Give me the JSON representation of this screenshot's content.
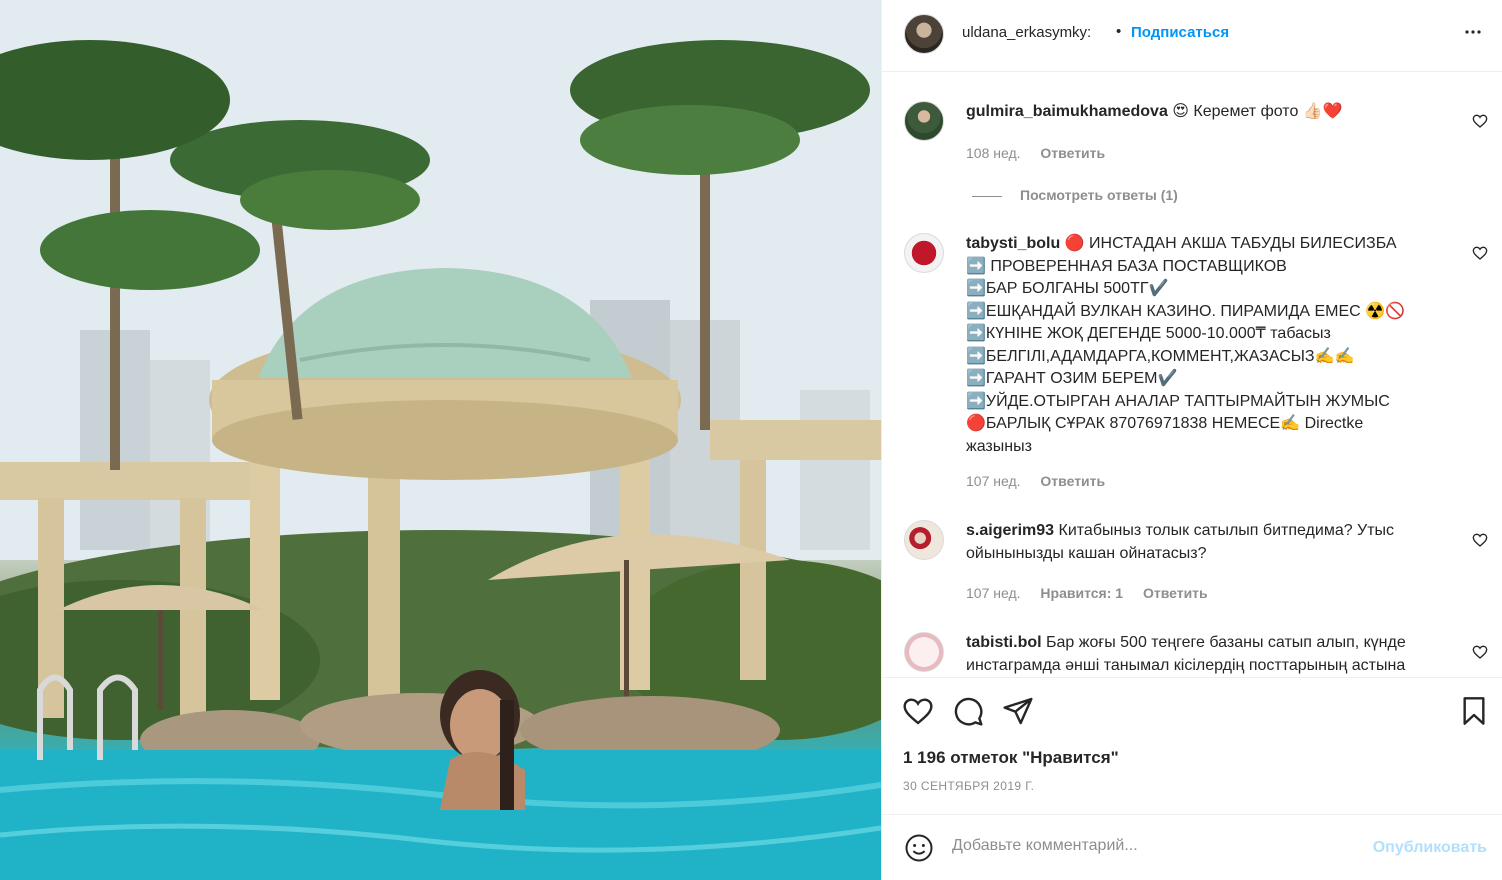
{
  "post": {
    "photo_icon": "pool-photo",
    "author": "uldana_erkasymky:",
    "separator": "•",
    "follow_label": "Подписаться",
    "more_icon": "more-horizontal-icon"
  },
  "comments": [
    {
      "user": "gulmira_baimukhamedova",
      "text": "😍 Керемет фото 👍🏻❤️",
      "time": "108 нед.",
      "reply": "Ответить",
      "view_replies": "Посмотреть ответы (1)"
    },
    {
      "user": "tabysti_bolu",
      "lines": [
        "🔴 ИНСТАДАН АКША ТАБУДЫ БИЛЕСИЗБА",
        "➡️ ПРОВЕРЕННАЯ БАЗА ПОСТАВЩИКОВ",
        "➡️БАР БОЛГАНЫ 500ТГ✔️",
        "➡️ЕШҚАНДАЙ ВУЛКАН КАЗИНО. ПИРАМИДА ЕМЕС ☢️🚫",
        "➡️КҮНІНЕ ЖОҚ ДЕГЕНДЕ 5000-10.000₸ табасыз",
        "➡️БЕЛГІЛІ,АДАМДАРГА,КОММЕНТ,ЖАЗАСЫЗ✍️✍️",
        "➡️ГАРАНТ ОЗИМ БЕРЕМ✔️",
        "➡️УЙДЕ.ОТЫРГАН АНАЛАР ТАПТЫРМАЙТЫН ЖУМЫС",
        "🔴БАРЛЫҚ СҰРАК 87076971838 НЕМЕСЕ✍️ Directke",
        "жазыныз"
      ],
      "time": "107 нед.",
      "reply": "Ответить"
    },
    {
      "user": "s.aigerim93",
      "text": "Китабыныз толык сатылып битпедима? Утыс ойынынызды кашан ойнатасыз?",
      "time": "107 нед.",
      "likes": "Нравится: 1",
      "reply": "Ответить"
    },
    {
      "user": "tabisti.bol",
      "text": "Бар жоғы 500 теңгеге базаны сатып алып, күнде инстаграмда әнші танымал кісілердің посттарының астына"
    }
  ],
  "actions": {
    "like_icon": "heart-icon",
    "comment_icon": "comment-icon",
    "share_icon": "share-icon",
    "save_icon": "bookmark-icon",
    "likes_text": "1 196 отметок \"Нравится\"",
    "date": "30 СЕНТЯБРЯ 2019 Г."
  },
  "add_comment": {
    "emoji_icon": "emoji-icon",
    "placeholder": "Добавьте комментарий...",
    "publish_label": "Опубликовать"
  },
  "colors": {
    "accent": "#0095f6",
    "publish_disabled": "#b2dffc",
    "muted": "#8e8e8e",
    "text": "#262626",
    "border": "#efefef"
  }
}
